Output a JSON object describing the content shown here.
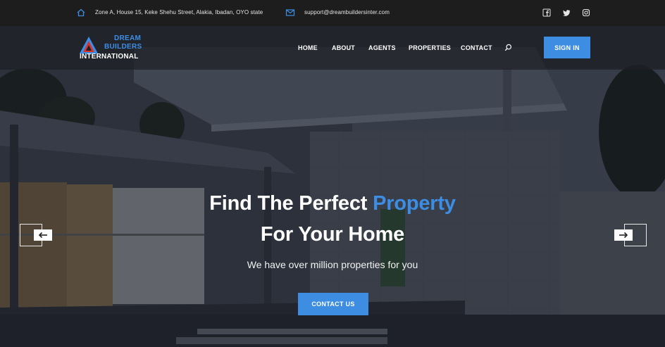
{
  "topbar": {
    "address": "Zone A, House 15, Keke Shehu Street, Alakia, Ibadan, OYO state",
    "email": "support@dreambuildersinter.com",
    "address_icon": "home-icon",
    "email_icon": "envelope-icon",
    "social_icons": [
      "facebook-icon",
      "twitter-icon",
      "instagram-icon"
    ]
  },
  "logo": {
    "line1": "DREAM",
    "line2": "BUILDERS",
    "line3": "INTERNATIONAL"
  },
  "nav": {
    "items": [
      "HOME",
      "ABOUT",
      "AGENTS",
      "PROPERTIES",
      "CONTACT"
    ],
    "search_icon": "search-icon",
    "signin_label": "SIGN IN"
  },
  "hero": {
    "title_part1": "Find The Perfect ",
    "title_accent": "Property",
    "title_line2": "For Your Home",
    "subtitle": "We have over million properties for you",
    "cta_label": "CONTACT US",
    "prev_icon": "arrow-left-icon",
    "next_icon": "arrow-right-icon"
  },
  "colors": {
    "accent": "#3d8de3",
    "topbar_bg": "#1d1d1d",
    "nav_bg": "#1e2026"
  }
}
